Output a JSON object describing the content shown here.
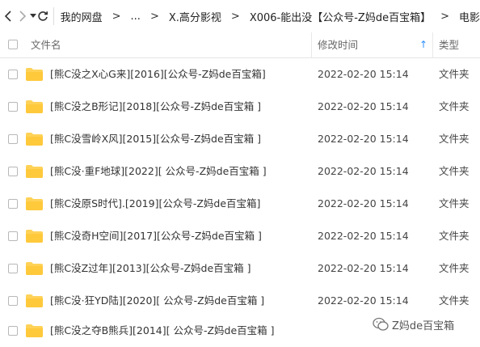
{
  "toolbar": {
    "breadcrumbs": [
      {
        "label": "我的网盘"
      },
      {
        "label": "..."
      },
      {
        "label": "X.高分影视"
      },
      {
        "label": "X006-能出没【公众号-Z妈de百宝箱】"
      },
      {
        "label": "电影"
      }
    ],
    "separator": ">"
  },
  "columns": {
    "name": "文件名",
    "modified": "修改时间",
    "type": "类型",
    "sort_indicator": "↑"
  },
  "files": [
    {
      "name": "[熊C没之X心G来][2016][公众号-Z妈de百宝箱]",
      "modified": "2022-02-20 15:14",
      "type": "文件夹"
    },
    {
      "name": "[熊C没之B形记][2018][公众号-Z妈de百宝箱 ]",
      "modified": "2022-02-20 15:14",
      "type": "文件夹"
    },
    {
      "name": "[熊C没雪岭X风][2015][公众号-Z妈de百宝箱 ]",
      "modified": "2022-02-20 15:14",
      "type": "文件夹"
    },
    {
      "name": "[熊C没·重F地球][2022][ 公众号-Z妈de百宝箱 ]",
      "modified": "2022-02-20 15:14",
      "type": "文件夹"
    },
    {
      "name": "[熊C没原S时代].[2019][公众号-Z妈de百宝箱]",
      "modified": "2022-02-20 15:14",
      "type": "文件夹"
    },
    {
      "name": "[熊C没奇H空间][2017][公众号-Z妈de百宝箱 ]",
      "modified": "2022-02-20 15:14",
      "type": "文件夹"
    },
    {
      "name": "[熊C没Z过年][2013][公众号-Z妈de百宝箱 ]",
      "modified": "2022-02-20 15:14",
      "type": "文件夹"
    },
    {
      "name": "[熊C没·狂YD陆][2020][ 公众号-Z妈de百宝箱 ]",
      "modified": "2022-02-20 15:14",
      "type": "文件夹"
    },
    {
      "name": "[熊C没之夺B熊兵][2014][ 公众号-Z妈de百宝箱 ]",
      "modified": "2022-02-20 15:14",
      "type": "文件夹"
    }
  ],
  "watermark": {
    "text": "Z妈de百宝箱"
  },
  "colors": {
    "folder": "#FFD257",
    "accent": "#2F8FFF",
    "text": "#333333"
  }
}
